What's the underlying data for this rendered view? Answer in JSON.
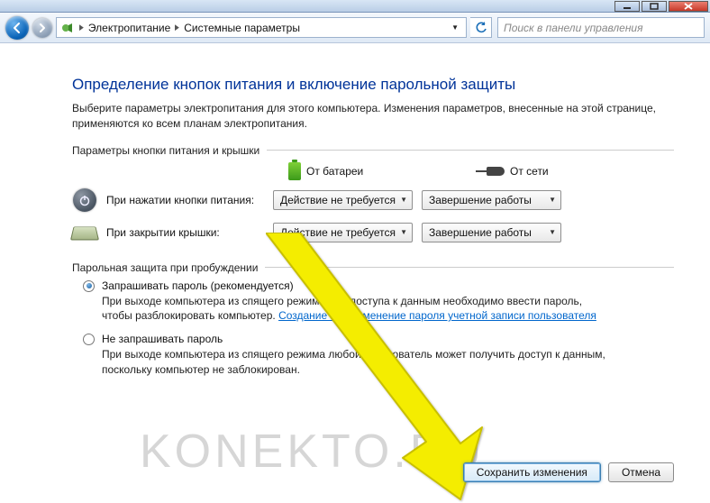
{
  "breadcrumb": {
    "item1": "Электропитание",
    "item2": "Системные параметры"
  },
  "search": {
    "placeholder": "Поиск в панели управления"
  },
  "page": {
    "title": "Определение кнопок питания и включение парольной защиты",
    "intro": "Выберите параметры электропитания для этого компьютера. Изменения параметров, внесенные на этой странице, применяются ко всем планам электропитания."
  },
  "section1": {
    "title": "Параметры кнопки питания и крышки",
    "col_battery": "От батареи",
    "col_plugged": "От сети",
    "row_power_label": "При нажатии кнопки питания:",
    "row_lid_label": "При закрытии крышки:",
    "combo_none": "Действие не требуется",
    "combo_shutdown": "Завершение работы"
  },
  "section2": {
    "title": "Парольная защита при пробуждении",
    "opt1_label": "Запрашивать пароль (рекомендуется)",
    "opt1_desc_pre": "При выходе компьютера из спящего режима для доступа к данным необходимо ввести пароль, чтобы разблокировать компьютер. ",
    "opt1_link": "Создание или изменение пароля учетной записи пользователя",
    "opt2_label": "Не запрашивать пароль",
    "opt2_desc": "При выходе компьютера из спящего режима любой пользователь может получить доступ к данным, поскольку компьютер не заблокирован."
  },
  "buttons": {
    "save": "Сохранить изменения",
    "cancel": "Отмена"
  },
  "watermark": "KONEKTO.RU"
}
